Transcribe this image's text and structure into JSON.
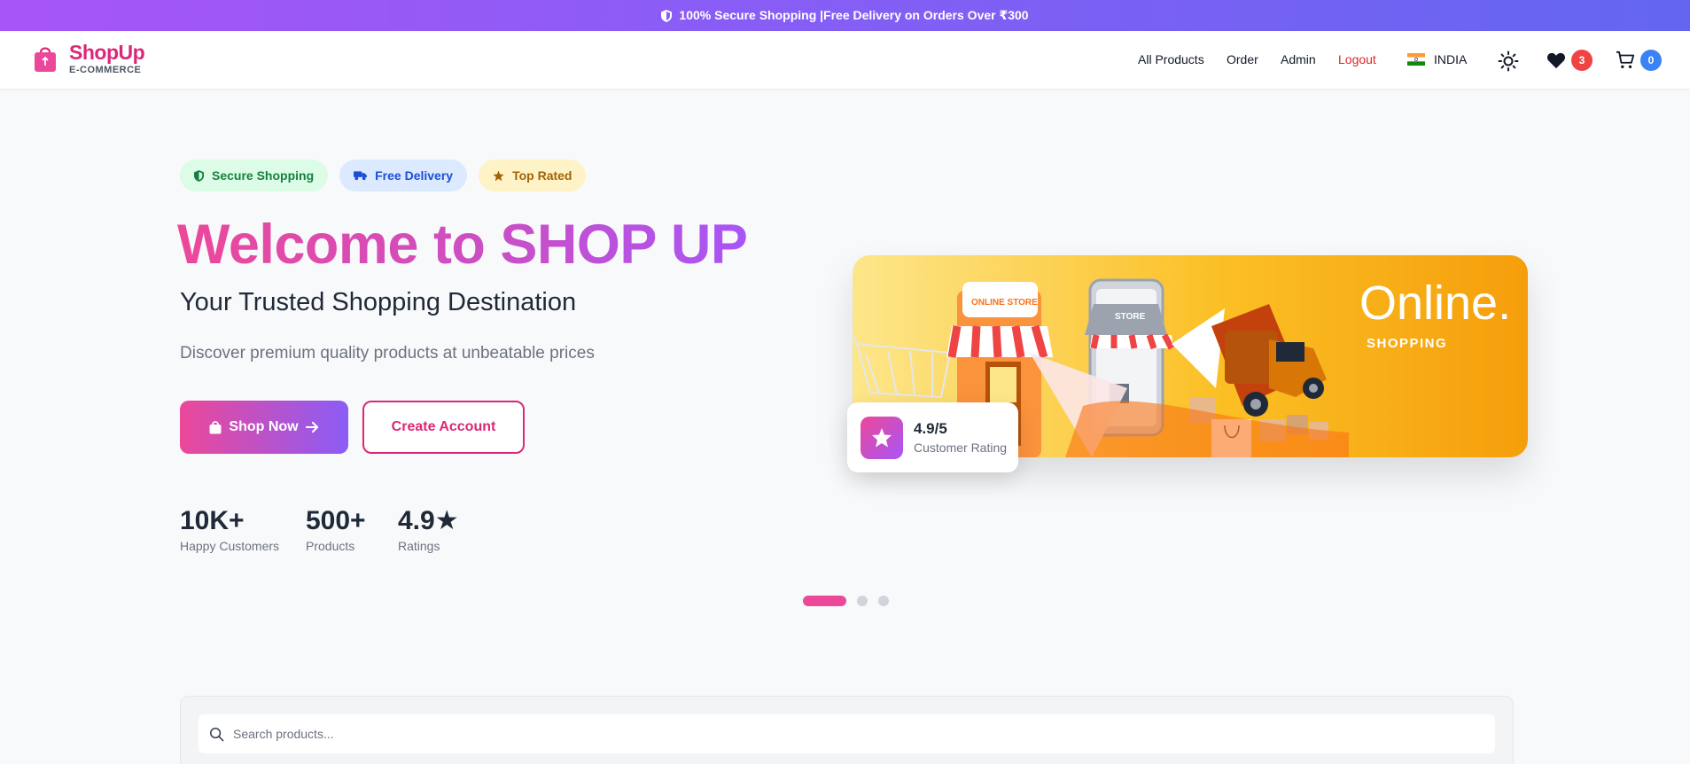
{
  "topbar": {
    "text": "100% Secure Shopping |Free Delivery on Orders Over ₹300"
  },
  "header": {
    "brand": "ShopUp",
    "brand_sub": "E-COMMERCE",
    "nav": [
      "All Products",
      "Order",
      "Admin",
      "Logout"
    ],
    "country": "INDIA",
    "wishlist_count": "3",
    "cart_count": "0"
  },
  "hero": {
    "pills": [
      "Secure Shopping",
      "Free Delivery",
      "Top Rated"
    ],
    "title": "Welcome to SHOP UP",
    "subtitle": "Your Trusted Shopping Destination",
    "description": "Discover premium quality products at unbeatable prices",
    "shop_button": "Shop Now",
    "create_button": "Create Account",
    "stats": [
      {
        "num": "10K+",
        "label": "Happy Customers"
      },
      {
        "num": "500+",
        "label": "Products"
      },
      {
        "num": "4.9★",
        "label": "Ratings"
      }
    ]
  },
  "banner": {
    "headline": "Online.",
    "sub": "SHOPPING",
    "store_sign": "ONLINE STORE",
    "phone_sign": "STORE"
  },
  "rating_card": {
    "value": "4.9/5",
    "label": "Customer Rating"
  },
  "carousel": {
    "slides": 3,
    "active": 1
  },
  "search": {
    "placeholder": "Search products..."
  },
  "colors": {
    "primary": "#ec4899",
    "secondary": "#8b5cf6",
    "logout": "#dc2626",
    "wishlist_badge": "#ef4444",
    "cart_badge": "#3b82f6"
  },
  "icons": [
    "shield-icon",
    "shopping-bag-icon",
    "india-flag-icon",
    "sun-icon",
    "heart-icon",
    "cart-icon",
    "truck-icon",
    "star-icon",
    "arrow-right-icon",
    "search-icon"
  ]
}
